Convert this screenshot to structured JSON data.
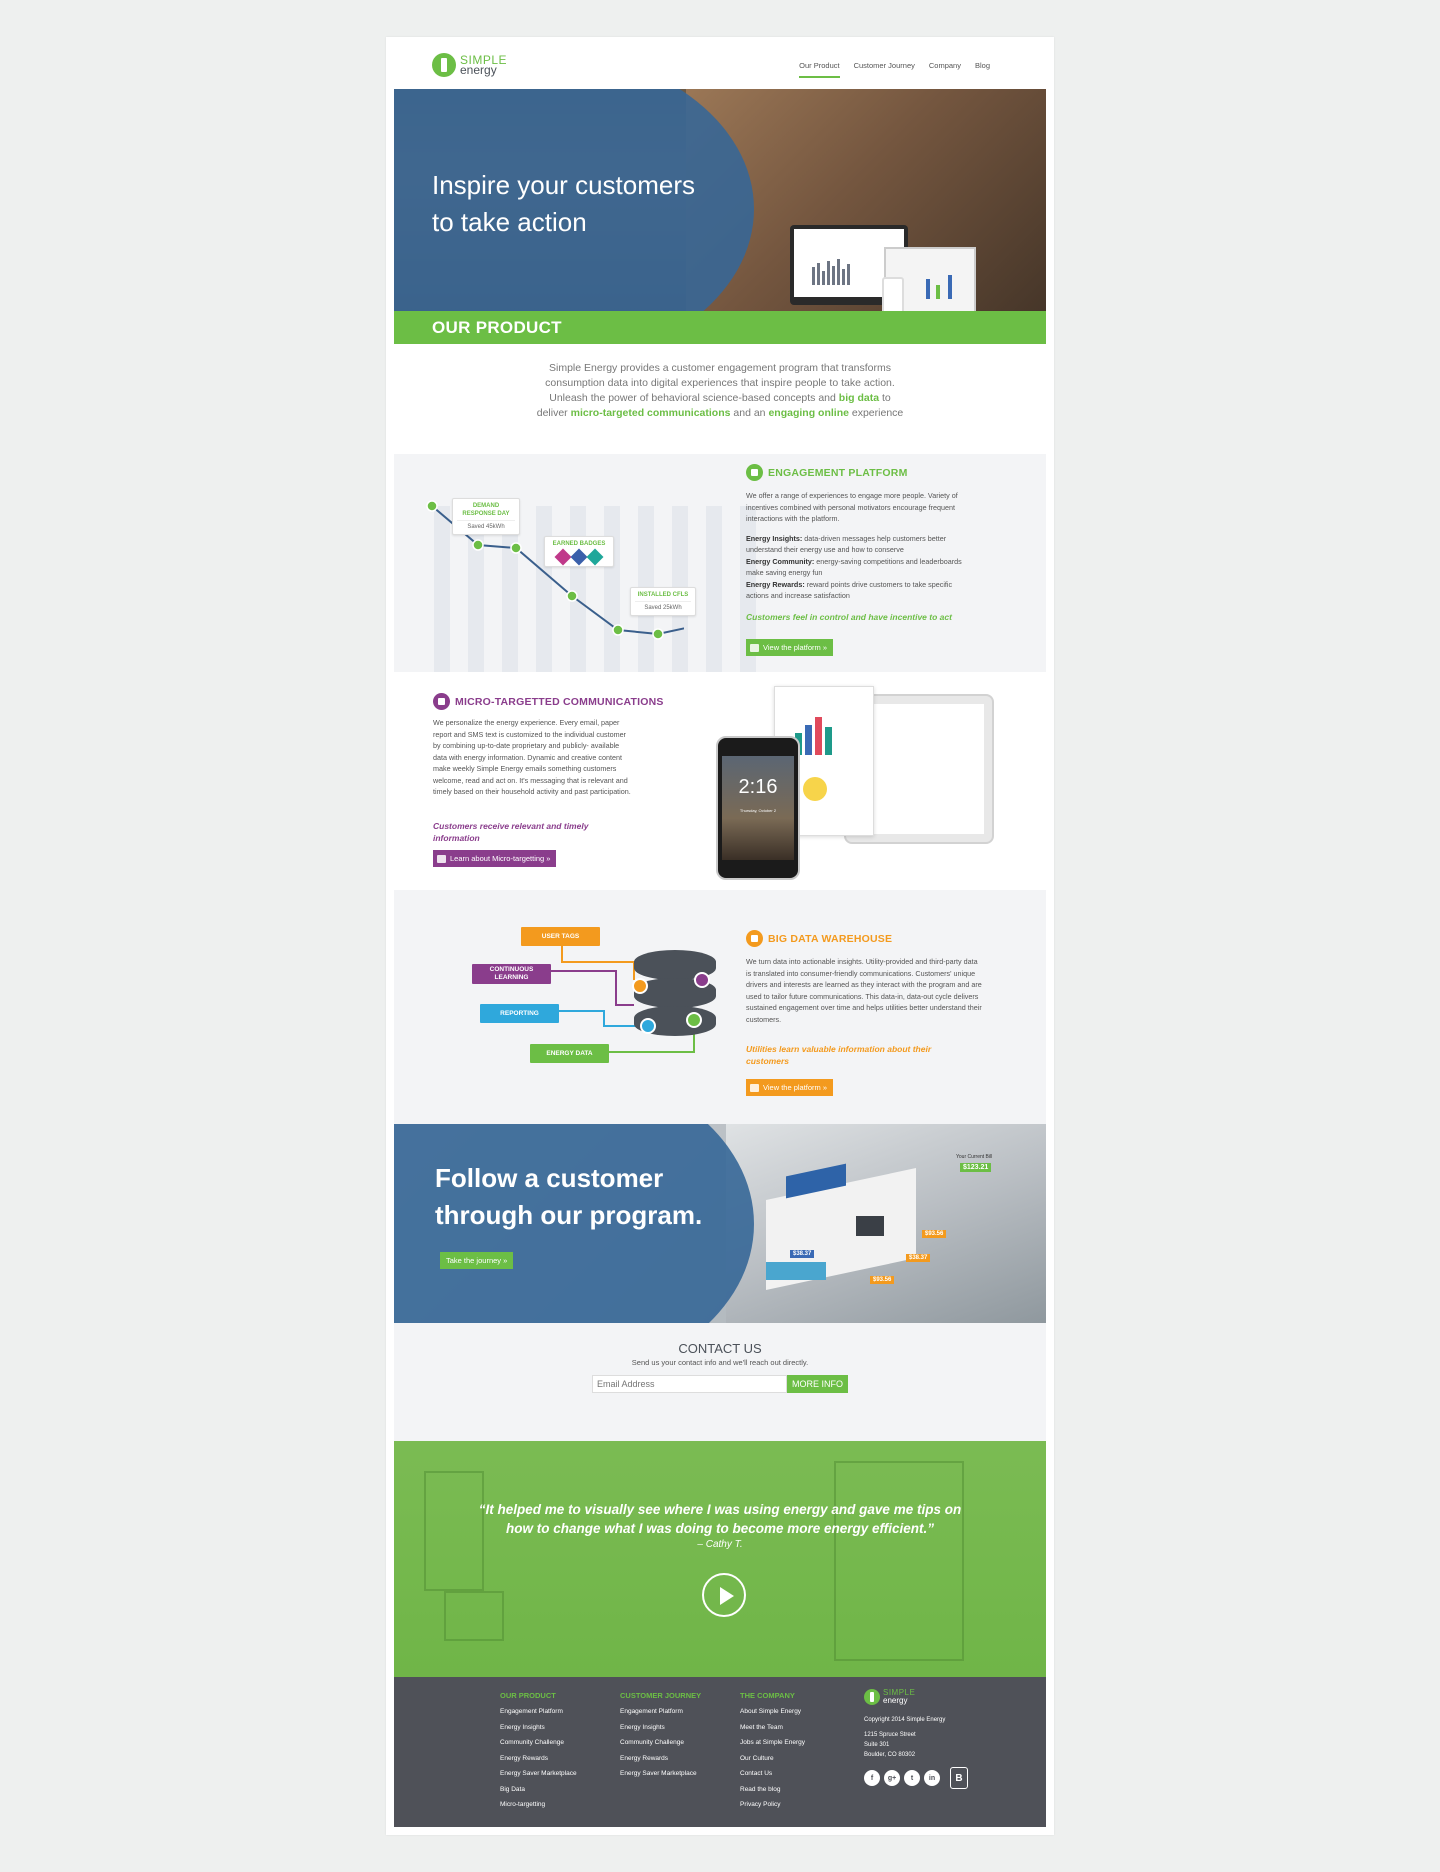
{
  "brand": {
    "simple": "SIMPLE",
    "energy": "energy",
    "green": "#6cbe45",
    "purple": "#8a3d8c",
    "orange": "#f39a1e"
  },
  "nav": [
    {
      "label": "Our Product",
      "active": true
    },
    {
      "label": "Customer Journey"
    },
    {
      "label": "Company"
    },
    {
      "label": "Blog"
    }
  ],
  "hero": {
    "line1": "Inspire your customers",
    "line2": "to take action",
    "section_label": "OUR PRODUCT"
  },
  "intro": {
    "l1": "Simple Energy provides a customer engagement program that transforms",
    "l2": "consumption data into digital experiences that inspire people to take action.",
    "l3a": "Unleash the power of behavioral science-based concepts and",
    "l3b": "big data",
    "l3c": "to",
    "l4a": "deliver",
    "l4b": "micro-targeted communications",
    "l4c": "and an",
    "l4d": "engaging online",
    "l4e": "experience"
  },
  "engagement": {
    "title": "ENGAGEMENT PLATFORM",
    "body": "We offer a range of experiences to engage more people. Variety of incentives combined with personal motivators encourage frequent interactions with the platform.",
    "items": [
      {
        "k": "Energy Insights:",
        "v": " data-driven messages help customers better understand their energy use and how to conserve"
      },
      {
        "k": "Energy Community:",
        "v": " energy-saving competitions and leaderboards make saving energy fun"
      },
      {
        "k": "Energy Rewards:",
        "v": " reward points drive customers to take specific actions and increase satisfaction"
      }
    ],
    "tagline": "Customers feel in control and have incentive to act",
    "button": "View the platform »",
    "callouts": {
      "demand_title": "DEMAND RESPONSE DAY",
      "demand_sub": "Saved 45kWh",
      "badges_title": "EARNED BADGES",
      "cfl_title": "INSTALLED CFLS",
      "cfl_sub": "Saved 25kWh"
    }
  },
  "micro": {
    "title": "MICRO-TARGETTED COMMUNICATIONS",
    "body": "We personalize the energy experience. Every email, paper report and SMS text is customized to the individual customer by combining up-to-date proprietary and publicly- available data with energy information. Dynamic and creative content make weekly Simple Energy emails something customers welcome, read and act on. It's messaging that is relevant and timely based on their household activity and past participation.",
    "tagline": "Customers receive relevant and timely information",
    "button": "Learn about Micro-targetting »",
    "phone_time": "2:16",
    "phone_date": "Thursday, October 2"
  },
  "bigdata": {
    "title": "BIG DATA WAREHOUSE",
    "body": "We turn data into actionable insights. Utility-provided and third-party data is translated into consumer-friendly communications. Customers' unique drivers and interests are learned as they interact with the program and are used to tailor future communications. This data-in, data-out cycle delivers sustained engagement over time and helps utilities better understand their customers.",
    "tagline": "Utilities learn valuable information about their customers",
    "button": "View the platform »",
    "tags": {
      "user_tags": "USER TAGS",
      "learning": "CONTINUOUS LEARNING",
      "reporting": "REPORTING",
      "energy_data": "ENERGY DATA"
    }
  },
  "follow": {
    "line1": "Follow a customer",
    "line2": "through our program.",
    "button": "Take the journey »",
    "bill_label": "Your Current Bill",
    "bill_amount": "$123.21",
    "amounts": [
      "$38.37",
      "$93.56",
      "$38.37",
      "$93.56"
    ]
  },
  "contact": {
    "title": "CONTACT US",
    "subtitle": "Send us your contact info and we'll reach out directly.",
    "placeholder": "Email Address",
    "button": "MORE INFO"
  },
  "testimonial": {
    "quote": "“It helped me to visually see where I was using energy and gave me tips on how to change what I was doing to become more energy efficient.”",
    "author": "– Cathy T."
  },
  "footer": {
    "product": {
      "title": "OUR PRODUCT",
      "links": [
        "Engagement Platform",
        "Energy Insights",
        "Community Challenge",
        "Energy Rewards",
        "Energy Saver Marketplace",
        "Big Data",
        "Micro-targetting"
      ]
    },
    "journey": {
      "title": "CUSTOMER JOURNEY",
      "links": [
        "Engagement Platform",
        "Energy Insights",
        "Community Challenge",
        "Energy Rewards",
        "Energy Saver Marketplace"
      ]
    },
    "company": {
      "title": "THE COMPANY",
      "links": [
        "About Simple Energy",
        "Meet the Team",
        "Jobs at Simple Energy",
        "Our Culture",
        "Contact Us",
        "Read the blog",
        "Privacy Policy"
      ]
    },
    "copyright": "Copyright 2014 Simple Energy",
    "address1": "1215 Spruce Street",
    "address2": "Suite 301",
    "address3": "Boulder, CO 80302",
    "social": [
      "f",
      "g+",
      "t",
      "in"
    ],
    "bcorp": "B"
  }
}
